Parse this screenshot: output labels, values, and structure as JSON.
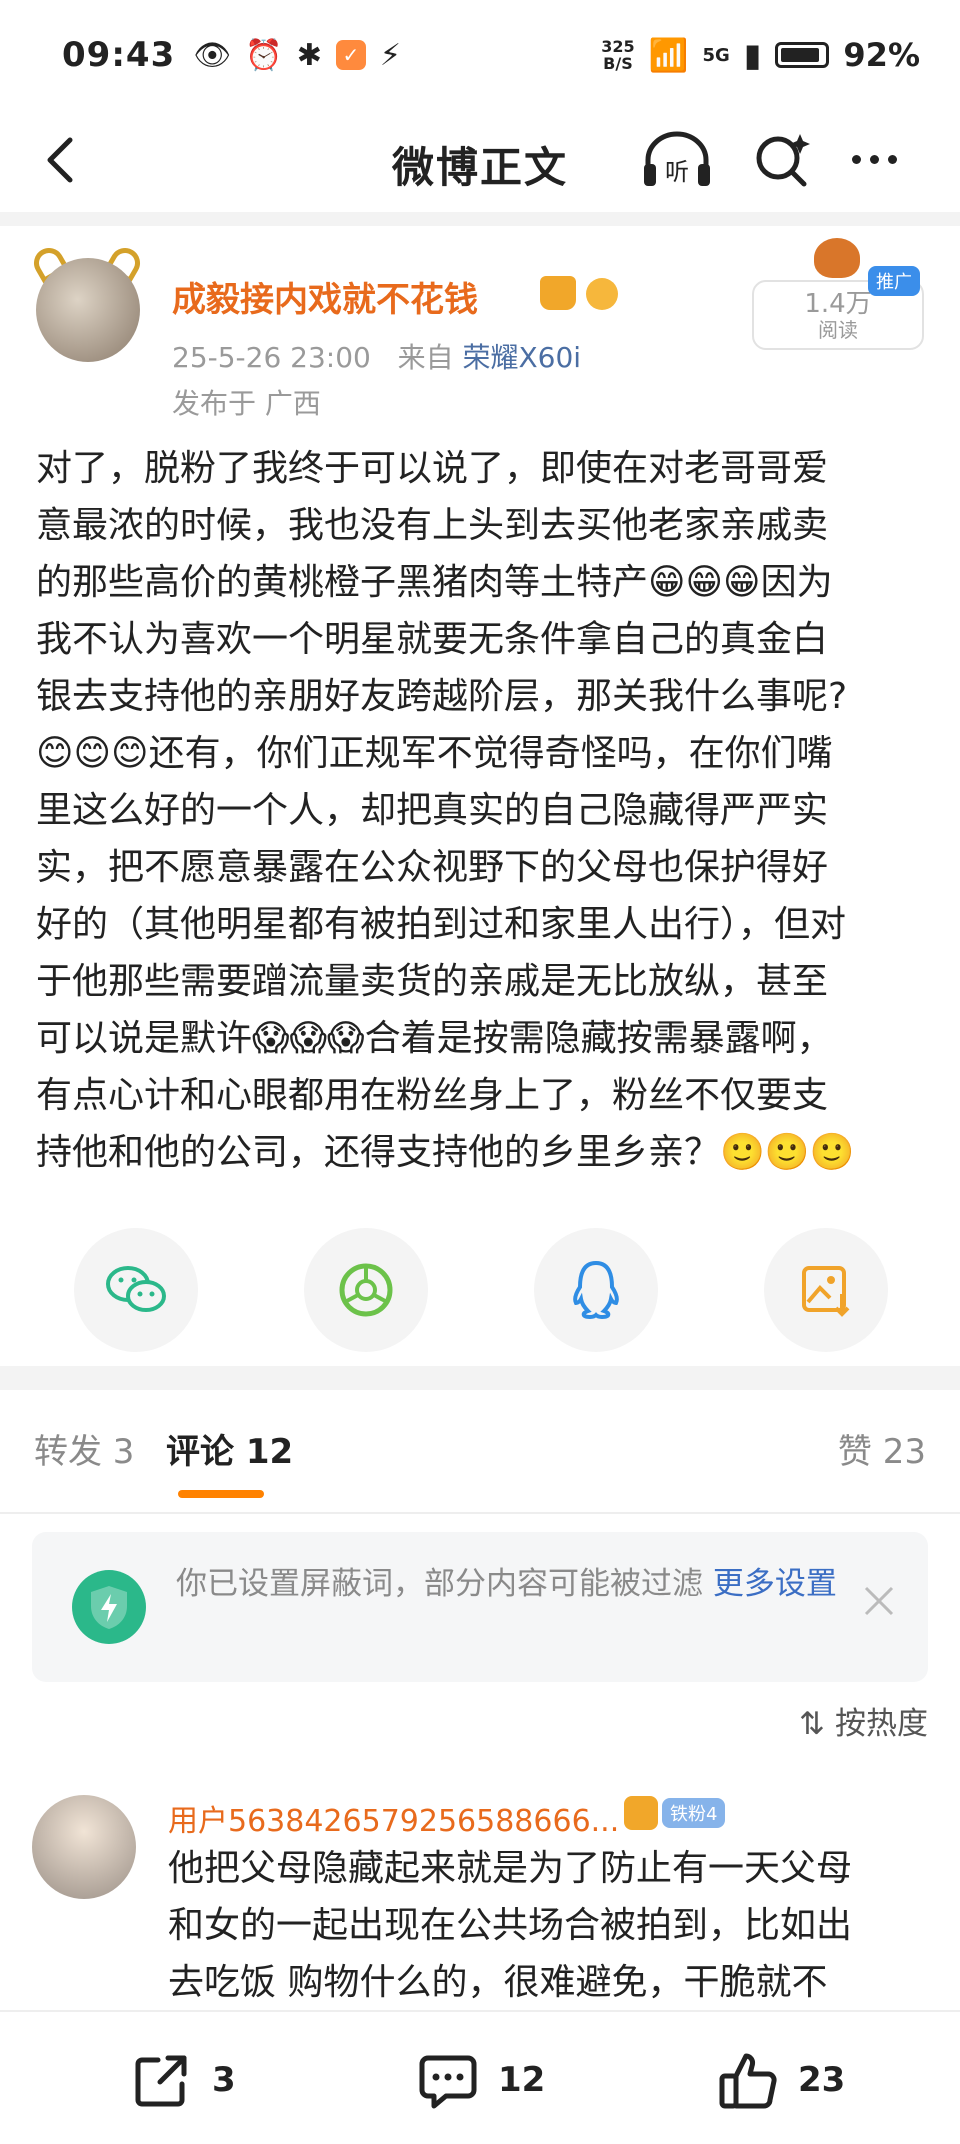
{
  "status": {
    "time": "09:43",
    "netspeed_value": "325",
    "netspeed_unit": "B/S",
    "network": "5G",
    "battery": "92%"
  },
  "nav": {
    "title": "微博正文",
    "listen_label": "听"
  },
  "post": {
    "username": "成毅接内戏就不花钱",
    "date": "25-5-26 23:00",
    "source_prefix": "来自",
    "device": "荣耀X60i",
    "location": "发布于 广西",
    "reads": "1.4万",
    "reads_label": "阅读",
    "promo_tag": "推广",
    "body_lines": [
      "对了，脱粉了我终于可以说了，即使在对老哥哥爱",
      "意最浓的时候，我也没有上头到去买他老家亲戚卖",
      "的那些高价的黄桃橙子黑猪肉等土特产😁😁😁因为",
      "我不认为喜欢一个明星就要无条件拿自己的真金白",
      "银去支持他的亲朋好友跨越阶层，那关我什么事呢?",
      "😊😊😊还有，你们正规军不觉得奇怪吗，在你们嘴",
      "里这么好的一个人，却把真实的自己隐藏得严严实",
      "实，把不愿意暴露在公众视野下的父母也保护得好",
      "好的（其他明星都有被拍到过和家里人出行），但对",
      "于他那些需要蹭流量卖货的亲戚是无比放纵，甚至",
      "可以说是默许😱😱😱合着是按需隐藏按需暴露啊，",
      "有点心计和心眼都用在粉丝身上了，粉丝不仅要支",
      "持他和他的公司，还得支持他的乡里乡亲？🙂🙂🙂"
    ]
  },
  "share": {
    "items": [
      "wechat-icon",
      "moments-icon",
      "qq-icon",
      "save-image-icon"
    ]
  },
  "tabs": {
    "repost": "转发 3",
    "comments": "评论 12",
    "likes": "赞 23"
  },
  "notice": {
    "text": "你已设置屏蔽词，部分内容可能被过滤 ",
    "link": "更多设置"
  },
  "sort": {
    "label": "按热度"
  },
  "comment": {
    "username": "用户5638426579256588666...",
    "fan_badge": "铁粉4",
    "text_lines": [
      "他把父母隐藏起来就是为了防止有一天父母",
      "和女的一起出现在公共场合被拍到，比如出",
      "去吃饭 购物什么的，很难避免，干脆就不"
    ]
  },
  "bottom": {
    "reposts": "3",
    "comments": "12",
    "likes": "23"
  },
  "colors": {
    "accent_orange": "#ff8200",
    "username_orange": "#e86a1c",
    "link_blue": "#3b6ec4",
    "shield_green": "#2bb88a"
  }
}
